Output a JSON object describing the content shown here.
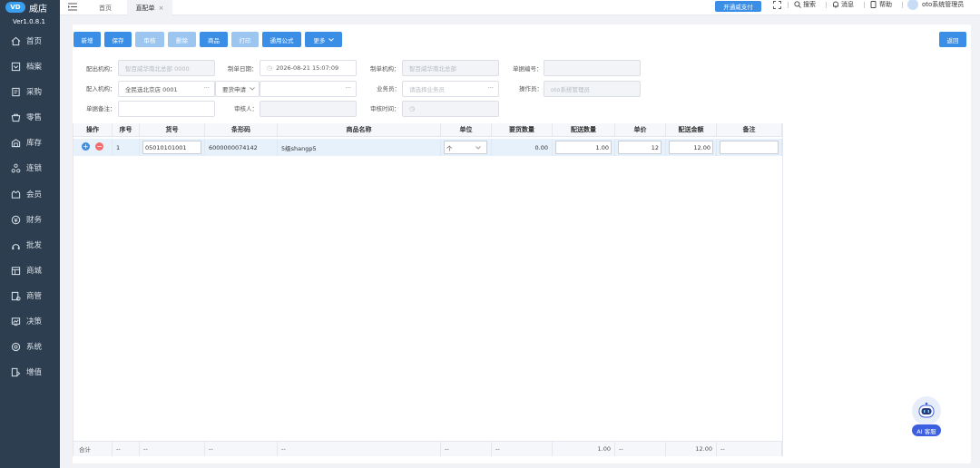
{
  "app": {
    "logo_mark": "VD",
    "logo_text": "威店",
    "version": "Ver1.0.8.1"
  },
  "sidebar": {
    "items": [
      {
        "label": "首页",
        "icon": "home-icon"
      },
      {
        "label": "档案",
        "icon": "archive-icon"
      },
      {
        "label": "采购",
        "icon": "purchase-icon"
      },
      {
        "label": "零售",
        "icon": "retail-icon"
      },
      {
        "label": "库存",
        "icon": "inventory-icon"
      },
      {
        "label": "连锁",
        "icon": "chain-icon"
      },
      {
        "label": "会员",
        "icon": "member-icon"
      },
      {
        "label": "财务",
        "icon": "finance-icon"
      },
      {
        "label": "批发",
        "icon": "wholesale-icon"
      },
      {
        "label": "商城",
        "icon": "mall-icon"
      },
      {
        "label": "商管",
        "icon": "merchant-icon"
      },
      {
        "label": "决策",
        "icon": "decision-icon"
      },
      {
        "label": "系统",
        "icon": "system-icon"
      },
      {
        "label": "增值",
        "icon": "value-added-icon"
      }
    ]
  },
  "topbar": {
    "tabs": [
      {
        "label": "首页"
      },
      {
        "label": "直配单",
        "close": "×"
      }
    ],
    "pay_button": "开通威支付",
    "search": "搜索",
    "messages": "消息",
    "help": "帮助",
    "user": "oto系统管理员"
  },
  "toolbar": {
    "new": "新增",
    "save": "保存",
    "audit": "审核",
    "delete": "删除",
    "goods": "商品",
    "print": "打印",
    "formula": "通用公式",
    "more": "更多",
    "back": "返回"
  },
  "form": {
    "out_org_label": "配出机构：",
    "out_org_value": "智百威华南北总部  0000",
    "date_label": "制单日期：",
    "date_value": "2026-08-21 15:07:09",
    "make_org_label": "制单机构：",
    "make_org_value": "智百威华南北总部",
    "bill_no_label": "单据编号：",
    "bill_no_value": "",
    "in_org_label": "配入机构：",
    "in_org_value": "全民选北京店  0001",
    "req_type_value": "要货申请",
    "req_no_value": "",
    "salesman_label": "业务员：",
    "salesman_placeholder": "请选择业务员",
    "operator_label": "操作员：",
    "operator_value": "oto系统管理员",
    "remark_label": "单据备注：",
    "remark_value": "",
    "auditor_label": "审核人：",
    "auditor_value": "",
    "audit_time_label": "审核时间："
  },
  "table": {
    "headers": [
      "操作",
      "序号",
      "货号",
      "条形码",
      "商品名称",
      "单位",
      "要货数量",
      "配送数量",
      "单价",
      "配送金额",
      "备注"
    ],
    "rows": [
      {
        "index": "1",
        "item_no": "05010101001",
        "barcode": "6000000074142",
        "name": "5级shangp5",
        "unit": "个",
        "req_qty": "0.00",
        "qty": "1.00",
        "price": "12",
        "amount": "12.00",
        "remark": ""
      }
    ],
    "footer": {
      "label": "合计",
      "dash": "--",
      "qty_total": "1.00",
      "amount_total": "12.00"
    }
  },
  "ai": {
    "label": "AI 客服"
  }
}
